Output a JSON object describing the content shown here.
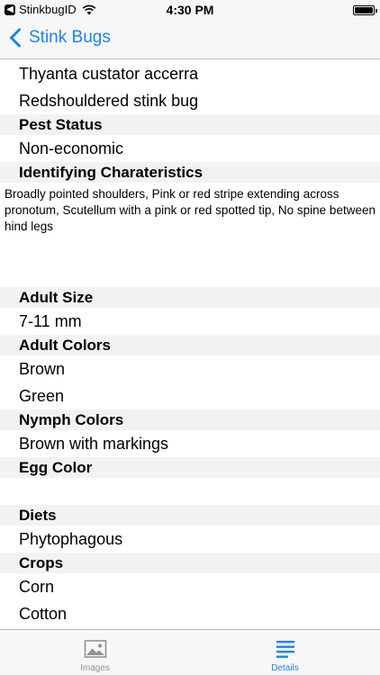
{
  "status_bar": {
    "back_app": "StinkbugID",
    "time": "4:30 PM"
  },
  "nav": {
    "back_label": "Stink Bugs"
  },
  "colors": {
    "accent": "#1a82fb",
    "section_bg": "#f2f2f2",
    "inactive_tab": "#929292"
  },
  "names": [
    "Thyanta custator accerra",
    "Redshouldered stink bug"
  ],
  "pest_status": {
    "header": "Pest Status",
    "value": "Non-economic"
  },
  "identifying": {
    "header": "Identifying Charateristics",
    "text": "Broadly pointed shoulders, Pink or red stripe extending across pronotum, Scutellum with a pink or red spotted tip, No spine between hind legs"
  },
  "adult_size": {
    "header": "Adult Size",
    "value": "7-11 mm"
  },
  "adult_colors": {
    "header": "Adult Colors",
    "values": [
      "Brown",
      "Green"
    ]
  },
  "nymph_colors": {
    "header": "Nymph Colors",
    "value": "Brown with markings"
  },
  "egg_color": {
    "header": "Egg Color",
    "value": ""
  },
  "diets": {
    "header": "Diets",
    "value": "Phytophagous"
  },
  "crops": {
    "header": "Crops",
    "values": [
      "Corn",
      "Cotton"
    ]
  },
  "tabs": [
    {
      "label": "Images",
      "icon": "image-icon",
      "active": false
    },
    {
      "label": "Details",
      "icon": "list-icon",
      "active": true
    }
  ]
}
